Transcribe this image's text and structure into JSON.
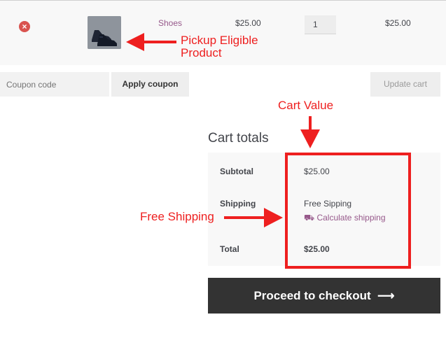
{
  "cart": {
    "row": {
      "remove_icon": "x-circle-icon",
      "product_name": "Shoes",
      "price": "$25.00",
      "quantity": "1",
      "subtotal": "$25.00"
    },
    "coupon": {
      "placeholder": "Coupon code",
      "apply_label": "Apply coupon"
    },
    "update_label": "Update cart"
  },
  "totals": {
    "title": "Cart totals",
    "subtotal_label": "Subtotal",
    "subtotal_value": "$25.00",
    "shipping_label": "Shipping",
    "shipping_value": "Free Sipping",
    "calculate_shipping": "Calculate shipping",
    "total_label": "Total",
    "total_value": "$25.00",
    "checkout_label": "Proceed to checkout"
  },
  "annotations": {
    "pickup_line1": "Pickup Eligible",
    "pickup_line2": "Product",
    "cart_value": "Cart Value",
    "free_shipping": "Free Shipping"
  },
  "colors": {
    "accent": "#96588a",
    "annotation": "#ee1f1f",
    "checkout_bg": "#333333"
  }
}
